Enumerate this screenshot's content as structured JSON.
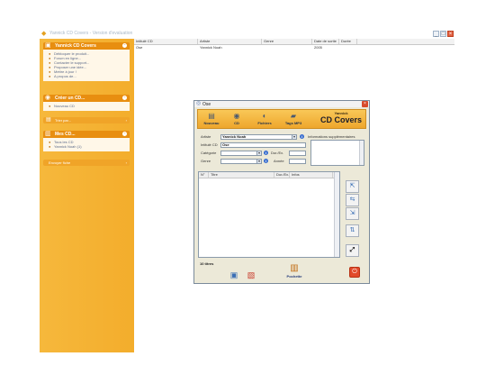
{
  "window": {
    "title": "Yannick CD Covers - Version d'evaluation",
    "minimize": "_",
    "maximize": "□",
    "close": "×"
  },
  "sidebar": {
    "panel_main": {
      "title": "Yannick CD Covers",
      "items": [
        {
          "label": "Débloquer le produit...",
          "icon": "key-icon"
        },
        {
          "label": "Forum en ligne...",
          "icon": "forum-icon"
        },
        {
          "label": "Contacter le support...",
          "icon": "mail-icon"
        },
        {
          "label": "Proposer une idée...",
          "icon": "bulb-icon"
        },
        {
          "label": "Mettre à jour !",
          "icon": "update-icon"
        },
        {
          "label": "A propos de...",
          "icon": "info-icon"
        }
      ]
    },
    "panel_create": {
      "title": "Créer un CD...",
      "items": [
        {
          "label": "Nouveau CD",
          "icon": "cd-icon"
        }
      ]
    },
    "panel_sort": {
      "title": "Trier par..."
    },
    "panel_print": {
      "title": "Mes CD...",
      "items": [
        {
          "label": "Tous les CD",
          "icon": "cd-icon"
        },
        {
          "label": "Yannick Noah (1)",
          "icon": "cd-icon"
        }
      ]
    },
    "panel_search": {
      "title": "Envoyer fiche"
    }
  },
  "list": {
    "columns": [
      "Intitulé CD",
      "Artiste",
      "Genre",
      "Date de sortie",
      "Durée"
    ],
    "rows": [
      {
        "title": "Ose",
        "artist": "Yannick Noah",
        "genre": "",
        "date": "2005",
        "duration": ""
      }
    ]
  },
  "dialog": {
    "title": "Ose",
    "toolbar": {
      "new": "Nouveau",
      "cd": "CD",
      "files": "Fichiers",
      "tags": "Tags MP3"
    },
    "brand": {
      "small": "Yannick",
      "big": "CD Covers"
    },
    "labels": {
      "artist": "Artiste",
      "title": "Intitulé CD",
      "category": "Catégorie",
      "genre": "Genre",
      "duration": "Dur./Ex.",
      "year": "Année",
      "info": "Informations supplémentaires"
    },
    "values": {
      "artist": "Yannick Noah",
      "title": "Ose",
      "category": "",
      "genre": "",
      "duration": "",
      "year": ""
    },
    "tracks_columns": [
      "N°",
      "Titre",
      "Dur./Ex.",
      "Infos"
    ],
    "count": "10 titres",
    "pochette": "Pochette"
  },
  "colors": {
    "sidebar": "#f4b235",
    "panel_header": "#e88e10",
    "toolbar": "#f2b440"
  }
}
